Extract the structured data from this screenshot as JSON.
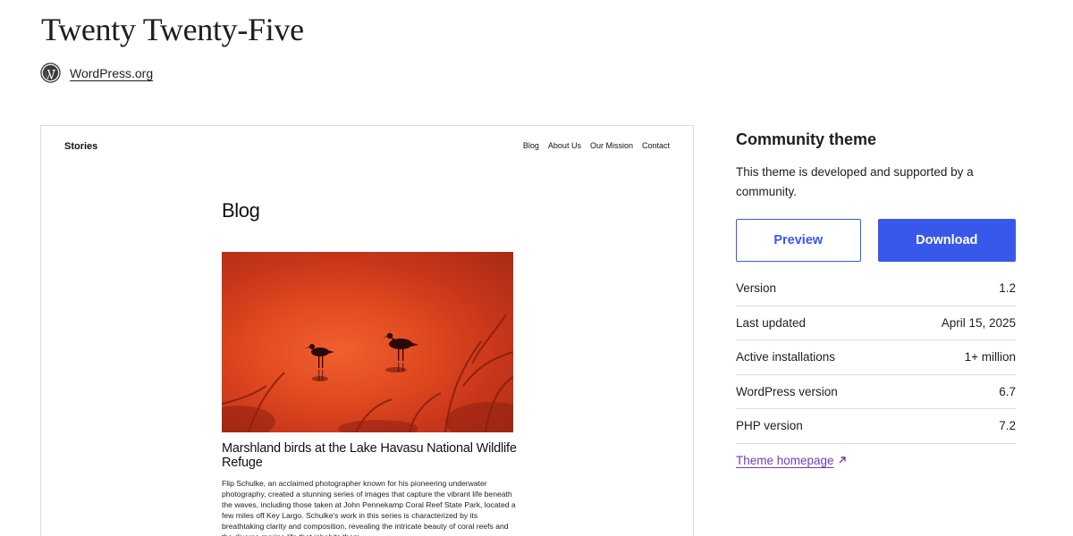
{
  "header": {
    "title": "Twenty Twenty-Five",
    "author_label": "WordPress.org",
    "logo_icon": "wordpress-logo-icon"
  },
  "preview": {
    "site_title": "Stories",
    "nav": [
      "Blog",
      "About Us",
      "Our Mission",
      "Contact"
    ],
    "page_heading": "Blog",
    "image_icon": "birds-photo",
    "post_title": "Marshland birds at the Lake Havasu National Wildlife Refuge",
    "post_excerpt": "Flip Schulke, an acclaimed photographer known for his pioneering underwater photography, created a stunning series of images that capture the vibrant life beneath the waves, including those taken at John Pennekamp Coral Reef State Park, located a few miles off Key Largo. Schulke's work in this series is characterized by its breathtaking clarity and composition, revealing the intricate beauty of coral reefs and the diverse marine life that inhabits them."
  },
  "sidebar": {
    "heading": "Community theme",
    "description": "This theme is developed and supported by a community.",
    "preview_button": "Preview",
    "download_button": "Download",
    "meta": [
      {
        "label": "Version",
        "value": "1.2"
      },
      {
        "label": "Last updated",
        "value": "April 15, 2025"
      },
      {
        "label": "Active installations",
        "value": "1+ million"
      },
      {
        "label": "WordPress version",
        "value": "6.7"
      },
      {
        "label": "PHP version",
        "value": "7.2"
      }
    ],
    "homepage_link": "Theme homepage",
    "homepage_icon": "external-arrow-icon"
  },
  "colors": {
    "accent": "#3858e9",
    "link_visited": "#6e3fb0",
    "border": "#dcdcde",
    "photo_orange": "#e04a20"
  }
}
